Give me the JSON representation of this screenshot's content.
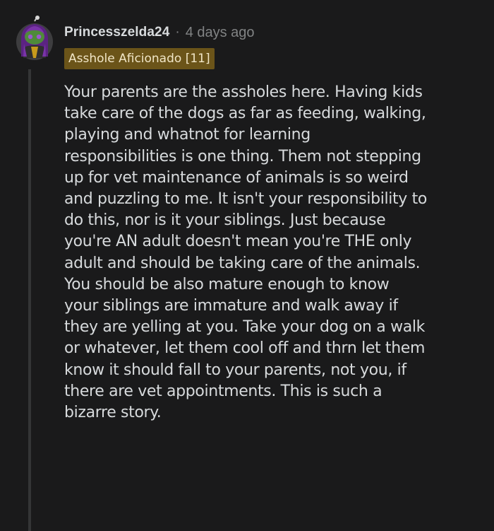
{
  "comment": {
    "username": "Princesszelda24",
    "separator": "·",
    "timestamp": "4 days ago",
    "flair": "Asshole Aficionado [11]",
    "avatar_icon": "snoo-avatar-icon",
    "body_lines": [
      "Your parents are the assholes here. Having kids",
      "take care of the dogs as far as feeding, walking,",
      "playing and whatnot for learning",
      "responsibilities is one thing. Them not stepping",
      "up for vet maintenance of animals is so weird",
      "and puzzling to me. It isn't your responsibility to",
      "do this, nor is it your siblings. Just because",
      "you're AN adult doesn't mean you're THE only",
      "adult and should be taking care of the animals.",
      "You should be also mature enough to know",
      "your siblings are immature and walk away if",
      "they are yelling at you. Take your dog on a walk",
      "or whatever, let them cool off and thrn let them",
      "know it should fall to your parents, not you, if",
      "there are vet appointments. This is such a",
      "bizarre story."
    ]
  },
  "colors": {
    "background": "#1a1a1b",
    "text": "#d7dadc",
    "meta": "#818384",
    "flair_bg": "#6b5419",
    "thread_line": "#343536",
    "avatar_bg": "#3a6e2c",
    "avatar_hair": "#6a2a8e"
  }
}
